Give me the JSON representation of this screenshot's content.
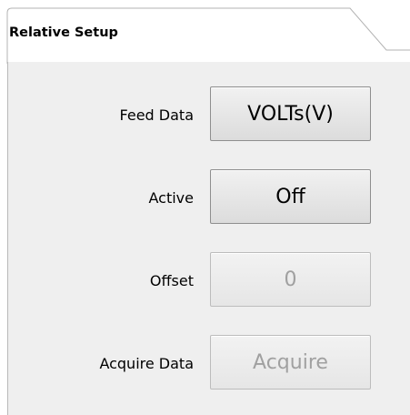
{
  "tab": {
    "title": "Relative Setup"
  },
  "rows": {
    "feed_data": {
      "label": "Feed Data",
      "value": "VOLTs(V)",
      "enabled": true
    },
    "active": {
      "label": "Active",
      "value": "Off",
      "enabled": true
    },
    "offset": {
      "label": "Offset",
      "value": "0",
      "enabled": false
    },
    "acquire_data": {
      "label": "Acquire Data",
      "value": "Acquire",
      "enabled": false
    }
  },
  "colors": {
    "panel_background": "#efefef",
    "button_border": "#8e8e8e",
    "disabled_text": "#a0a0a0",
    "label_text": "#000000"
  }
}
